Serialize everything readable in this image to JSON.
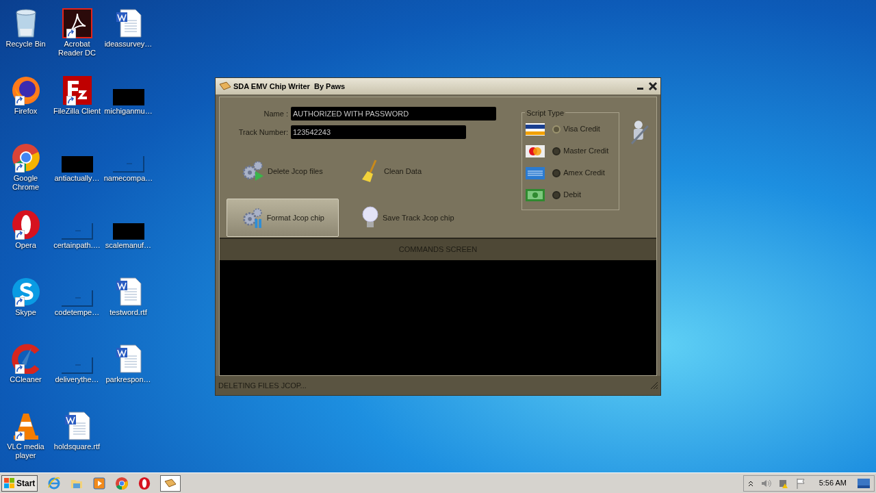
{
  "desktop_icons": [
    {
      "label": "Recycle Bin",
      "kind": "recycle",
      "shortcut": false
    },
    {
      "label": "Firefox",
      "kind": "firefox",
      "shortcut": true
    },
    {
      "label": "Google Chrome",
      "kind": "chrome",
      "shortcut": true
    },
    {
      "label": "Opera",
      "kind": "opera",
      "shortcut": true
    },
    {
      "label": "Skype",
      "kind": "skype",
      "shortcut": true
    },
    {
      "label": "CCleaner",
      "kind": "ccleaner",
      "shortcut": true
    },
    {
      "label": "VLC media player",
      "kind": "vlc",
      "shortcut": true
    },
    {
      "label": "Acrobat Reader DC",
      "kind": "acrobat",
      "shortcut": true
    },
    {
      "label": "FileZilla Client",
      "kind": "filezilla",
      "shortcut": true
    },
    {
      "label": "antiactually…",
      "kind": "black",
      "shortcut": false
    },
    {
      "label": "certainpath.…",
      "kind": "blank",
      "shortcut": false
    },
    {
      "label": "codetempe…",
      "kind": "blank",
      "shortcut": false
    },
    {
      "label": "deliverythe…",
      "kind": "blank",
      "shortcut": false
    },
    {
      "label": "holdsquare.rtf",
      "kind": "word",
      "shortcut": false
    },
    {
      "label": "ideassurvey…",
      "kind": "word",
      "shortcut": false
    },
    {
      "label": "michiganmu…",
      "kind": "black",
      "shortcut": false
    },
    {
      "label": "namecompa…",
      "kind": "blank",
      "shortcut": false
    },
    {
      "label": "scalemanuf…",
      "kind": "black",
      "shortcut": false
    },
    {
      "label": "testword.rtf",
      "kind": "word",
      "shortcut": false
    },
    {
      "label": "parkrespon…",
      "kind": "word",
      "shortcut": false
    }
  ],
  "window": {
    "title": "SDA EMV Chip Writer  By Paws",
    "fields": [
      {
        "label": "Name :",
        "value": "AUTHORIZED WITH PASSWORD"
      },
      {
        "label": "Track Number:",
        "value": "123542243"
      }
    ],
    "actions": [
      {
        "label": "Delete Jcop files",
        "kind": "gears-play",
        "hovered": false
      },
      {
        "label": "Clean Data",
        "kind": "broom",
        "hovered": false
      },
      {
        "label": "Format Jcop chip",
        "kind": "gears-bars",
        "hovered": true
      },
      {
        "label": "Save Track Jcop chip",
        "kind": "bulb",
        "hovered": false
      }
    ],
    "script_type": {
      "legend": "Script Type",
      "options": [
        {
          "label": "Visa Credit",
          "kind": "visa",
          "selected": true
        },
        {
          "label": "Master Credit",
          "kind": "master",
          "selected": false
        },
        {
          "label": "Amex Credit",
          "kind": "amex",
          "selected": false
        },
        {
          "label": "Debit",
          "kind": "cash",
          "selected": false
        }
      ]
    },
    "commands_header": "COMMANDS SCREEN",
    "status": "DELETING FILES JCOP..."
  },
  "taskbar": {
    "start": "Start",
    "items": [
      {
        "kind": "ie",
        "active": false
      },
      {
        "kind": "folder",
        "active": false
      },
      {
        "kind": "media",
        "active": false
      },
      {
        "kind": "chrome",
        "active": false
      },
      {
        "kind": "opera",
        "active": false
      },
      {
        "kind": "app",
        "active": true
      }
    ],
    "clock": "5:56 AM"
  }
}
